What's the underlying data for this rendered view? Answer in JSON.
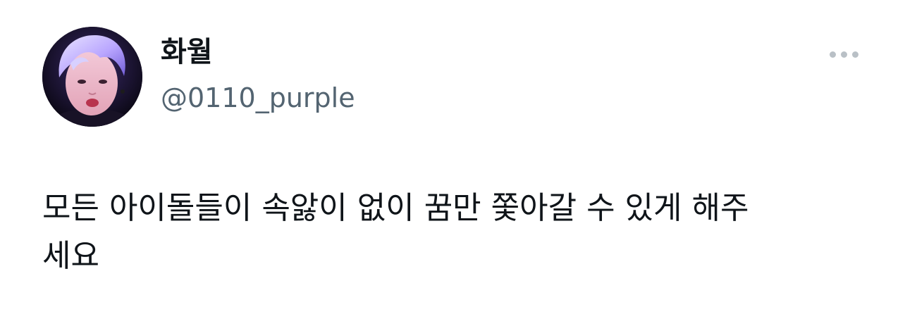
{
  "tweet": {
    "author": {
      "display_name": "화월",
      "handle": "@0110_purple",
      "avatar_icon": "profile-photo"
    },
    "more_icon": "more-horizontal-icon",
    "text": "모든 아이돌들이 속앓이 없이 꿈만 쫓아갈 수 있게 해주\n세요"
  },
  "colors": {
    "primary_text": "#0f1419",
    "secondary_text": "#536471",
    "menu_dots": "#b9c0c6",
    "background": "#ffffff"
  }
}
